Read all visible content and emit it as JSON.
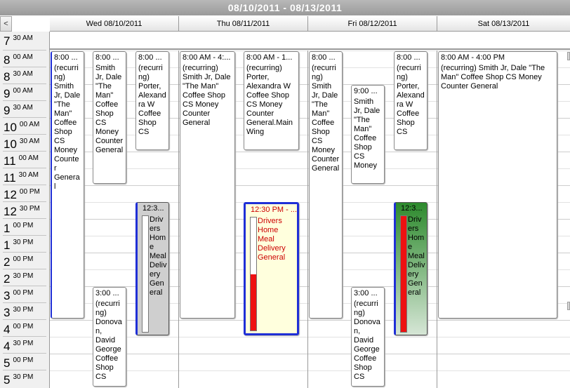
{
  "window": {
    "title": "08/10/2011 - 08/13/2011"
  },
  "nav": {
    "prev_label": "<"
  },
  "days": [
    {
      "label": "Wed 08/10/2011"
    },
    {
      "label": "Thu 08/11/2011"
    },
    {
      "label": "Fri 08/12/2011"
    },
    {
      "label": "Sat 08/13/2011"
    }
  ],
  "times": [
    {
      "hour": "7",
      "min": "30 AM"
    },
    {
      "hour": "8",
      "min": "00 AM"
    },
    {
      "hour": "8",
      "min": "30 AM"
    },
    {
      "hour": "9",
      "min": "00 AM"
    },
    {
      "hour": "9",
      "min": "30 AM"
    },
    {
      "hour": "10",
      "min": "00 AM"
    },
    {
      "hour": "10",
      "min": "30 AM"
    },
    {
      "hour": "11",
      "min": "00 AM"
    },
    {
      "hour": "11",
      "min": "30 AM"
    },
    {
      "hour": "12",
      "min": "00 PM"
    },
    {
      "hour": "12",
      "min": "30 PM"
    },
    {
      "hour": "1",
      "min": "00 PM"
    },
    {
      "hour": "1",
      "min": "30 PM"
    },
    {
      "hour": "2",
      "min": "00 PM"
    },
    {
      "hour": "2",
      "min": "30 PM"
    },
    {
      "hour": "3",
      "min": "00 PM"
    },
    {
      "hour": "3",
      "min": "30 PM"
    },
    {
      "hour": "4",
      "min": "00 PM"
    },
    {
      "hour": "4",
      "min": "30 PM"
    },
    {
      "hour": "5",
      "min": "00 PM"
    },
    {
      "hour": "5",
      "min": "30 PM"
    }
  ],
  "appointments": {
    "wed_1": {
      "time": "8:00 ...",
      "text": "(recurring) Smith Jr, Dale \"The Man\" Coffee Shop CS Money Counter General"
    },
    "wed_2": {
      "time": "8:00 ...",
      "text": "Smith Jr, Dale \"The Man\" Coffee Shop CS Money Counter General"
    },
    "wed_3": {
      "time": "8:00 ...",
      "text": "(recurring) Porter, Alexandra W Coffee Shop CS"
    },
    "wed_4": {
      "time": "12:3...",
      "text": "Drivers Home Meal Delivery General",
      "progress": 0
    },
    "wed_5": {
      "time": "3:00 ...",
      "text": "(recurring) Donovan, David George Coffee Shop CS"
    },
    "thu_1": {
      "time": "8:00 AM - 4:...",
      "text": "(recurring) Smith Jr, Dale \"The Man\" Coffee Shop CS Money Counter General"
    },
    "thu_2": {
      "time": "8:00 AM - 1...",
      "text": "(recurring) Porter, Alexandra W Coffee Shop CS Money Counter General.Main Wing"
    },
    "thu_3": {
      "time": "12:30 PM - ...",
      "text": "Drivers Home Meal Delivery General",
      "progress": 0.5
    },
    "fri_1": {
      "time": "8:00 ...",
      "text": "(recurring) Smith Jr, Dale \"The Man\" Coffee Shop CS Money Counter General"
    },
    "fri_2": {
      "time": "9:00 ...",
      "text": "Smith Jr, Dale \"The Man\" Coffee Shop CS Money"
    },
    "fri_3": {
      "time": "8:00 ...",
      "text": "(recurring) Porter, Alexandra W Coffee Shop CS"
    },
    "fri_4": {
      "time": "12:3...",
      "text": "Drivers Home Meal Delivery General",
      "progress": 1.0
    },
    "fri_5": {
      "time": "3:00 ...",
      "text": "(recurring) Donovan, David George Coffee Shop CS"
    },
    "sat_1": {
      "time": "8:00 AM - 4:00 PM",
      "text": "(recurring) Smith Jr, Dale \"The Man\" Coffee Shop CS Money Counter General"
    }
  },
  "colors": {
    "header_gray": "#a8a8a8",
    "status_blue": "#1f2fd6",
    "progress_red": "#ee1111",
    "wed_bg": "#cfcfcf",
    "thu_bg": "#ffffdd",
    "thu_text": "#cc0000",
    "fri_bg_top": "#2d8a2d",
    "fri_bg_bottom": "#d6e6d6"
  }
}
